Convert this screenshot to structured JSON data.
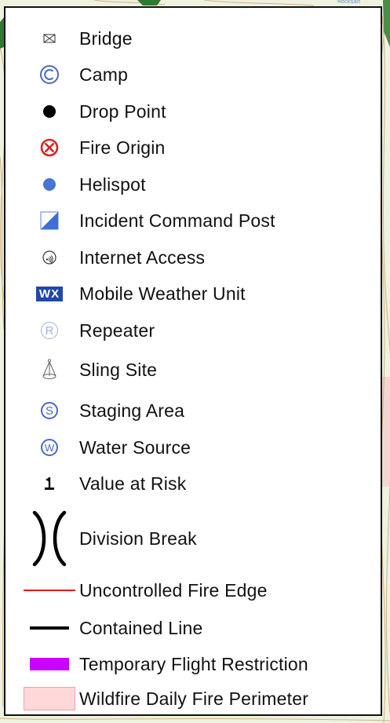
{
  "legend": {
    "items": [
      {
        "label": "Bridge",
        "icon": "bridge-icon"
      },
      {
        "label": "Camp",
        "icon": "camp-icon"
      },
      {
        "label": "Drop Point",
        "icon": "drop-point-icon"
      },
      {
        "label": "Fire Origin",
        "icon": "fire-origin-icon"
      },
      {
        "label": "Helispot",
        "icon": "helispot-icon"
      },
      {
        "label": "Incident Command Post",
        "icon": "incident-command-post-icon"
      },
      {
        "label": "Internet Access",
        "icon": "internet-access-icon"
      },
      {
        "label": "Mobile Weather Unit",
        "icon": "mobile-weather-unit-icon",
        "badge": "WX"
      },
      {
        "label": "Repeater",
        "icon": "repeater-icon",
        "letter": "R"
      },
      {
        "label": "Sling Site",
        "icon": "sling-site-icon"
      },
      {
        "label": "Staging Area",
        "icon": "staging-area-icon",
        "letter": "S"
      },
      {
        "label": "Water Source",
        "icon": "water-source-icon",
        "letter": "W"
      },
      {
        "label": "Value at Risk",
        "icon": "value-at-risk-icon"
      },
      {
        "label": "Division Break",
        "icon": "division-break-icon"
      },
      {
        "label": "Uncontrolled Fire Edge",
        "icon": "uncontrolled-fire-edge-line"
      },
      {
        "label": "Contained Line",
        "icon": "contained-line"
      },
      {
        "label": "Temporary Flight Restriction",
        "icon": "temporary-flight-restriction-swatch"
      },
      {
        "label": "Wildfire Daily Fire Perimeter",
        "icon": "wildfire-daily-fire-perimeter-swatch"
      }
    ]
  },
  "colors": {
    "symbol_blue": "#4a68c8",
    "fire_origin_red": "#e02020",
    "uncontrolled_edge_red": "#e8161b",
    "tfr_purple": "#cc00ff",
    "perimeter_pink": "#ffd9d9",
    "perimeter_border": "#f1a0a0",
    "wx_blue": "#1f48a8"
  }
}
